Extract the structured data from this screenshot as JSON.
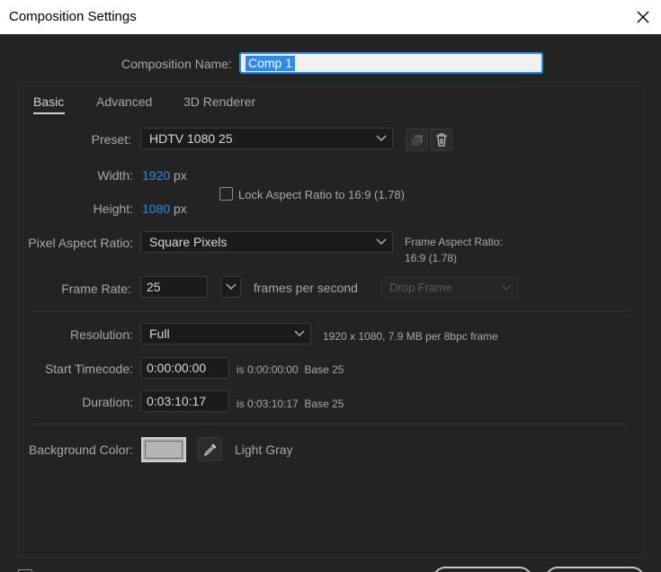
{
  "window": {
    "title": "Composition Settings",
    "close_icon": "close-icon"
  },
  "comp_name": {
    "label": "Composition Name:",
    "value": "Comp 1"
  },
  "tabs": [
    {
      "label": "Basic",
      "active": true
    },
    {
      "label": "Advanced",
      "active": false
    },
    {
      "label": "3D Renderer",
      "active": false
    }
  ],
  "preset": {
    "label": "Preset:",
    "value": "HDTV 1080 25"
  },
  "width": {
    "label": "Width:",
    "value": "1920",
    "unit": "px"
  },
  "height": {
    "label": "Height:",
    "value": "1080",
    "unit": "px"
  },
  "lock_aspect": {
    "label": "Lock Aspect Ratio to 16:9 (1.78)",
    "checked": false
  },
  "pixel_aspect": {
    "label": "Pixel Aspect Ratio:",
    "value": "Square Pixels"
  },
  "frame_aspect": {
    "label": "Frame Aspect Ratio:",
    "value": "16:9 (1.78)"
  },
  "frame_rate": {
    "label": "Frame Rate:",
    "value": "25",
    "suffix": "frames per second",
    "drop_frame": "Drop Frame"
  },
  "resolution": {
    "label": "Resolution:",
    "value": "Full",
    "info": "1920 x 1080, 7.9 MB per 8bpc frame"
  },
  "start_timecode": {
    "label": "Start Timecode:",
    "value": "0:00:00:00",
    "info": "is 0:00:00:00  Base 25"
  },
  "duration": {
    "label": "Duration:",
    "value": "0:03:10:17",
    "info": "is 0:03:10:17  Base 25"
  },
  "background": {
    "label": "Background Color:",
    "color_name": "Light Gray",
    "color": "#b4b4b4"
  },
  "colors": {
    "accent": "#2d8ceb",
    "panel_bg": "#232323",
    "field_bg": "#1b1b1b"
  }
}
